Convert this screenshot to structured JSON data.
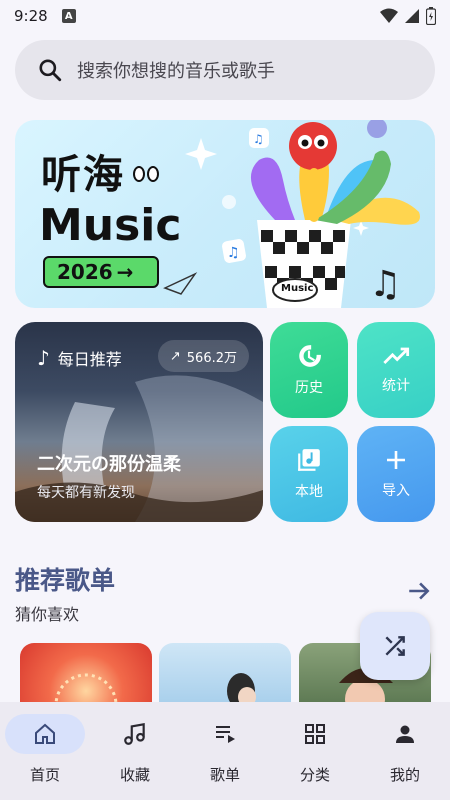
{
  "status_bar": {
    "time": "9:28",
    "indicator": "A"
  },
  "search": {
    "placeholder": "搜索你想搜的音乐或歌手"
  },
  "banner": {
    "title_cn": "听海",
    "title_en": "Music",
    "year": "2026",
    "cup_text": "Music"
  },
  "daily": {
    "label": "每日推荐",
    "count": "566.2万",
    "title": "二次元の那份温柔",
    "subtitle": "每天都有新发现"
  },
  "tiles": [
    {
      "label": "历史",
      "icon": "history-icon"
    },
    {
      "label": "统计",
      "icon": "trending-icon"
    },
    {
      "label": "本地",
      "icon": "music-library-icon"
    },
    {
      "label": "导入",
      "icon": "plus-icon"
    }
  ],
  "section": {
    "title": "推荐歌单",
    "subtitle": "猜你喜欢"
  },
  "nav": [
    {
      "label": "首页",
      "icon": "home-icon"
    },
    {
      "label": "收藏",
      "icon": "music-note-icon"
    },
    {
      "label": "歌单",
      "icon": "playlist-icon"
    },
    {
      "label": "分类",
      "icon": "grid-icon"
    },
    {
      "label": "我的",
      "icon": "person-icon"
    }
  ],
  "colors": {
    "accent": "#4a5888",
    "nav_active": "#d8e1fb"
  }
}
